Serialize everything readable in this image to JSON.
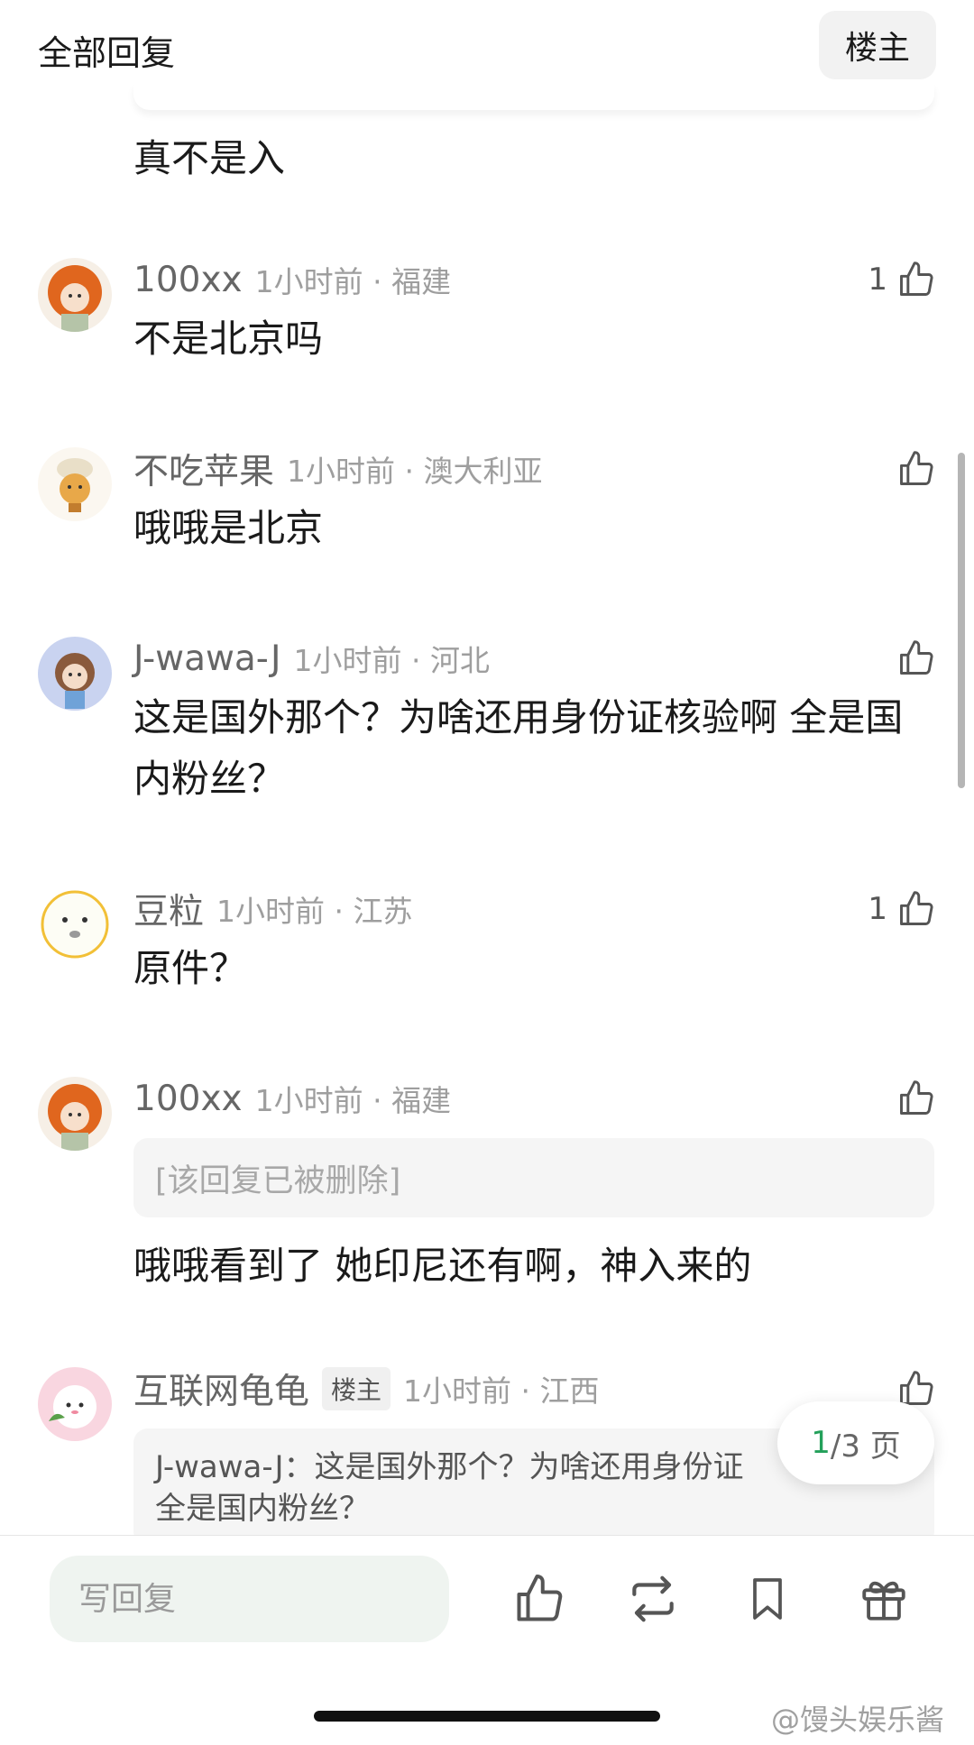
{
  "header": {
    "title": "全部回复",
    "op_filter": "楼主"
  },
  "orphan_reply": {
    "text": "真不是入"
  },
  "comments": [
    {
      "username": "100xx",
      "time_location": "1小时前 · 福建",
      "text": "不是北京吗",
      "likes": "1"
    },
    {
      "username": "不吃苹果",
      "time_location": "1小时前 · 澳大利亚",
      "text": "哦哦是北京",
      "likes": ""
    },
    {
      "username": "J-wawa-J",
      "time_location": "1小时前 · 河北",
      "text": "这是国外那个？为啥还用身份证核验啊 全是国内粉丝？",
      "likes": ""
    },
    {
      "username": "豆粒",
      "time_location": "1小时前 · 江苏",
      "text": "原件？",
      "likes": "1"
    },
    {
      "username": "100xx",
      "time_location": "1小时前 · 福建",
      "deleted": "[该回复已被删除]",
      "text": "哦哦看到了 她印尼还有啊，神入来的",
      "likes": ""
    },
    {
      "username": "互联网龟龟",
      "badge": "楼主",
      "time_location": "1小时前 · 江西",
      "quote_line1": "J-wawa-J：这是国外那个？为啥还用身份证",
      "quote_line2": "全是国内粉丝？",
      "likes": ""
    }
  ],
  "pagination": {
    "current": "1",
    "total": "/3 页"
  },
  "bottom_bar": {
    "reply_placeholder": "写回复",
    "icons": [
      "like-icon",
      "repost-icon",
      "bookmark-icon",
      "gift-icon"
    ]
  },
  "watermark": "@馒头娱乐酱",
  "colors": {
    "accent_green": "#23a05a",
    "input_bg": "#eff4f0"
  }
}
